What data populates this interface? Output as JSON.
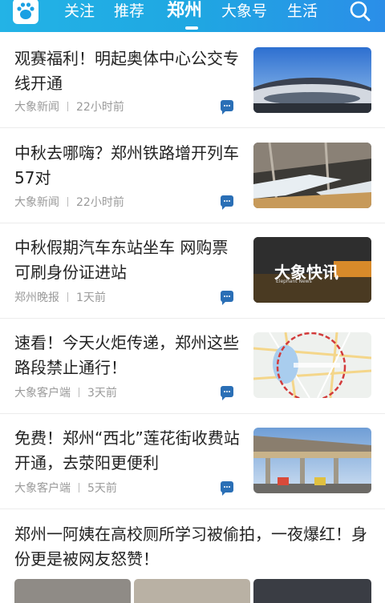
{
  "nav": {
    "tabs": [
      "关注",
      "推荐",
      "郑州",
      "大象号",
      "生活"
    ],
    "active_tab": "郑州"
  },
  "articles": [
    {
      "title": "观赛福利！明起奥体中心公交专线开通",
      "source": "大象新闻",
      "time": "22小时前"
    },
    {
      "title": "中秋去哪嗨？郑州铁路增开列车57对",
      "source": "大象新闻",
      "time": "22小时前"
    },
    {
      "title": "中秋假期汽车东站坐车 网购票可刷身份证进站",
      "source": "郑州晚报",
      "time": "1天前",
      "thumb_text": "大象快讯",
      "thumb_sub": "Elephant News"
    },
    {
      "title": "速看！今天火炬传递，郑州这些路段禁止通行！",
      "source": "大象客户端",
      "time": "3天前"
    },
    {
      "title": "免费！郑州“西北”莲花街收费站开通，去荥阳更便利",
      "source": "大象客户端",
      "time": "5天前"
    }
  ],
  "featured": {
    "title": "郑州一阿姨在高校厕所学习被偷拍，一夜爆红！身份更是被网友怒赞！"
  },
  "colors": {
    "nav_start": "#23b3e6",
    "nav_end": "#2b8ee8",
    "comment_icon": "#2a6fb6"
  }
}
